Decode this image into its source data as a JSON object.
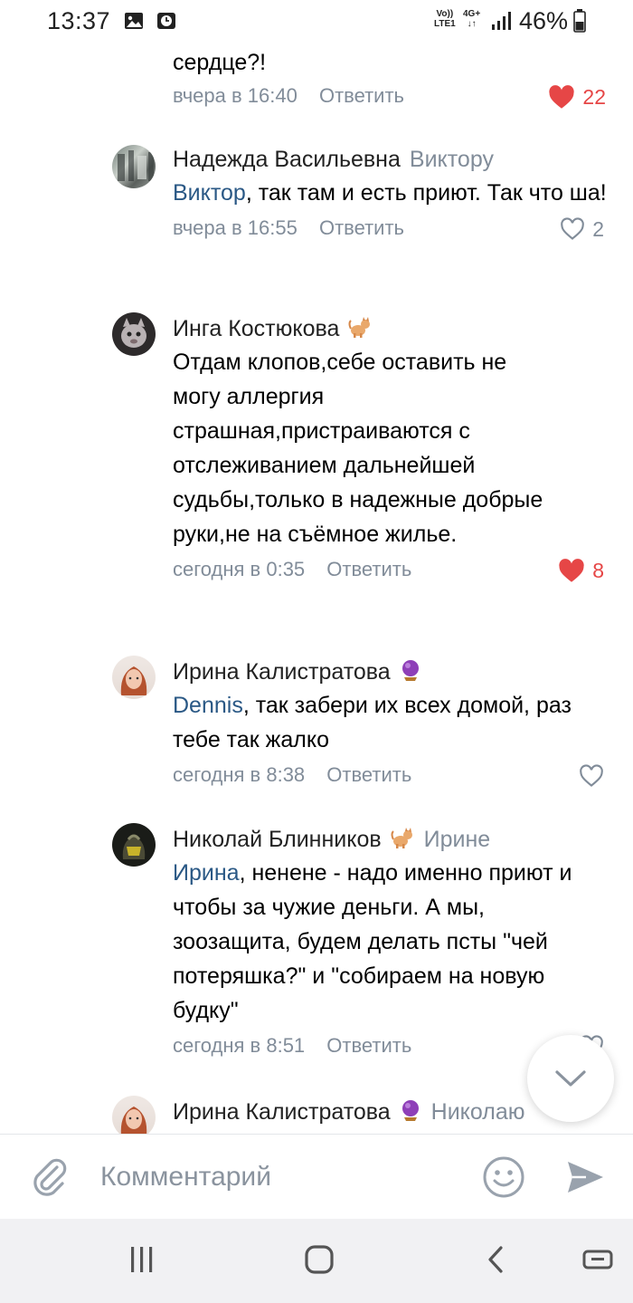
{
  "status_bar": {
    "time": "13:37",
    "network_top": "Vo))",
    "network_bottom": "LTE1",
    "gen_label": "4G+",
    "battery": "46%",
    "icons": [
      "gallery-icon",
      "clock-icon",
      "signal-icon",
      "battery-icon"
    ]
  },
  "top_partial": {
    "text": "сердце?!",
    "time": "вчера в 16:40",
    "reply": "Ответить",
    "likes": "22",
    "liked": true
  },
  "comments": [
    {
      "author": "Надежда Васильевна",
      "reply_to": "Виктору",
      "mention": "Виктор",
      "text": ", так там и есть приют. Так что ша!",
      "time": "вчера в 16:55",
      "reply": "Ответить",
      "likes": "2",
      "liked": false
    },
    {
      "author": "Инга Костюкова",
      "emoji": "cat-emoji",
      "text": "Отдам клопов,себе оставить не могу аллергия страшная,пристраиваются с отслеживанием дальнейшей судьбы,только в надежные добрые руки,не на съёмное жилье.",
      "time": "сегодня в 0:35",
      "reply": "Ответить",
      "likes": "8",
      "liked": true
    },
    {
      "author": "Ирина Калистратова",
      "emoji": "crystal-ball-emoji",
      "mention": "Dennis",
      "text": ", так забери их всех домой, раз тебе так жалко",
      "time": "сегодня в 8:38",
      "reply": "Ответить",
      "likes": "",
      "liked": false
    },
    {
      "author": "Николай Блинников",
      "emoji": "cat-emoji",
      "reply_to": "Ирине",
      "mention": "Ирина",
      "text": ", ненене - надо именно приют и чтобы за чужие деньги. А мы, зоозащита, будем делать псты \"чей потеряшка?\" и \"собираем на новую будку\"",
      "time": "сегодня в 8:51",
      "reply": "Ответить",
      "likes": "",
      "liked": false
    },
    {
      "author": "Ирина Калистратова",
      "emoji": "crystal-ball-emoji",
      "reply_to": "Николаю"
    }
  ],
  "composer": {
    "placeholder": "Комментарий"
  },
  "colors": {
    "link": "#2a5885",
    "meta": "#818c99",
    "like_active": "#e64646"
  }
}
